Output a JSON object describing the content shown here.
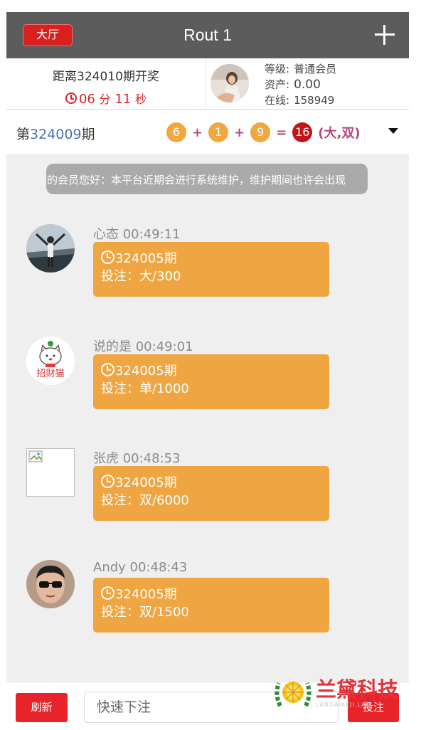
{
  "header": {
    "hall_label": "大厅",
    "title": "Rout 1"
  },
  "draw": {
    "next_label": "距离324010期开奖",
    "minutes": "06",
    "min_unit": "分",
    "seconds": "11",
    "sec_unit": "秒"
  },
  "user": {
    "level_label": "等级:",
    "level": "普通会员",
    "assets_label": "资产:",
    "assets": "0.00",
    "online_label": "在线:",
    "online": "158949"
  },
  "last_result": {
    "prefix": "第",
    "period": "324009",
    "suffix": "期",
    "balls": [
      "6",
      "1",
      "9"
    ],
    "plus": "+",
    "equals": "=",
    "sum": "16",
    "outcome": "(大,双)"
  },
  "notice": "敬的会员您好：本平台近期会进行系统维护，维护期间也许会出现",
  "messages": [
    {
      "name": "心态",
      "time": "00:49:11",
      "period": "324005期",
      "bet": "投注：大/300"
    },
    {
      "name": "说的是",
      "time": "00:49:01",
      "period": "324005期",
      "bet": "投注：单/1000",
      "avatar_text": "招财猫"
    },
    {
      "name": "张虎",
      "time": "00:48:53",
      "period": "324005期",
      "bet": "投注：双/6000"
    },
    {
      "name": "Andy",
      "time": "00:48:43",
      "period": "324005期",
      "bet": "投注：双/1500"
    }
  ],
  "footer": {
    "refresh_label": "刷新",
    "quick_placeholder": "快速下注",
    "bet_label": "投注"
  },
  "watermark": {
    "brand": "兰黛科技",
    "sub": "LANDAIKEJI.LAN"
  },
  "colors": {
    "header_bg": "#5c5c5c",
    "accent_red": "#e8242a",
    "bubble_orange": "#eea542",
    "ball_orange": "#f0a73e",
    "sum_red": "#c0151b",
    "outcome_pink": "#b8477f"
  }
}
